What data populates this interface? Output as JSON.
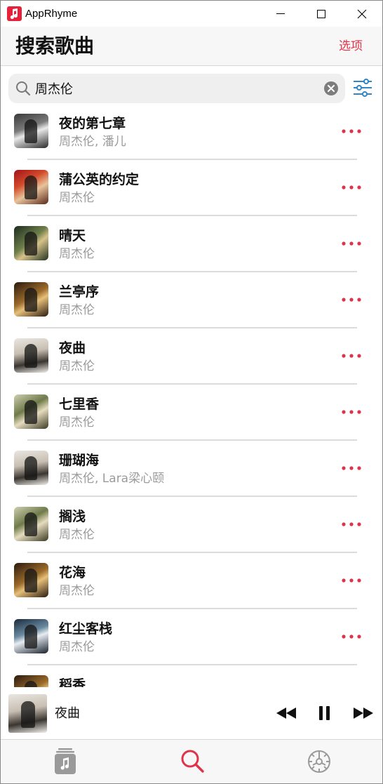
{
  "window": {
    "title": "AppRhyme"
  },
  "header": {
    "title": "搜索歌曲",
    "options_label": "选项"
  },
  "search": {
    "value": "周杰伦"
  },
  "songs": [
    {
      "title": "夜的第七章",
      "artist": "周杰伦, 潘儿"
    },
    {
      "title": "蒲公英的约定",
      "artist": "周杰伦"
    },
    {
      "title": "晴天",
      "artist": "周杰伦"
    },
    {
      "title": "兰亭序",
      "artist": "周杰伦"
    },
    {
      "title": "夜曲",
      "artist": "周杰伦"
    },
    {
      "title": "七里香",
      "artist": "周杰伦"
    },
    {
      "title": "珊瑚海",
      "artist": "周杰伦, Lara梁心颐"
    },
    {
      "title": "搁浅",
      "artist": "周杰伦"
    },
    {
      "title": "花海",
      "artist": "周杰伦"
    },
    {
      "title": "红尘客栈",
      "artist": "周杰伦"
    },
    {
      "title": "稻香",
      "artist": ""
    }
  ],
  "now_playing": {
    "title": "夜曲"
  },
  "tabs": [
    {
      "icon": "music-library-icon"
    },
    {
      "icon": "search-icon",
      "active": true
    },
    {
      "icon": "settings-icon"
    }
  ],
  "colors": {
    "accent": "#e0334a",
    "filter_blue": "#2f86c8",
    "icon_gray": "#9a9a9a"
  }
}
